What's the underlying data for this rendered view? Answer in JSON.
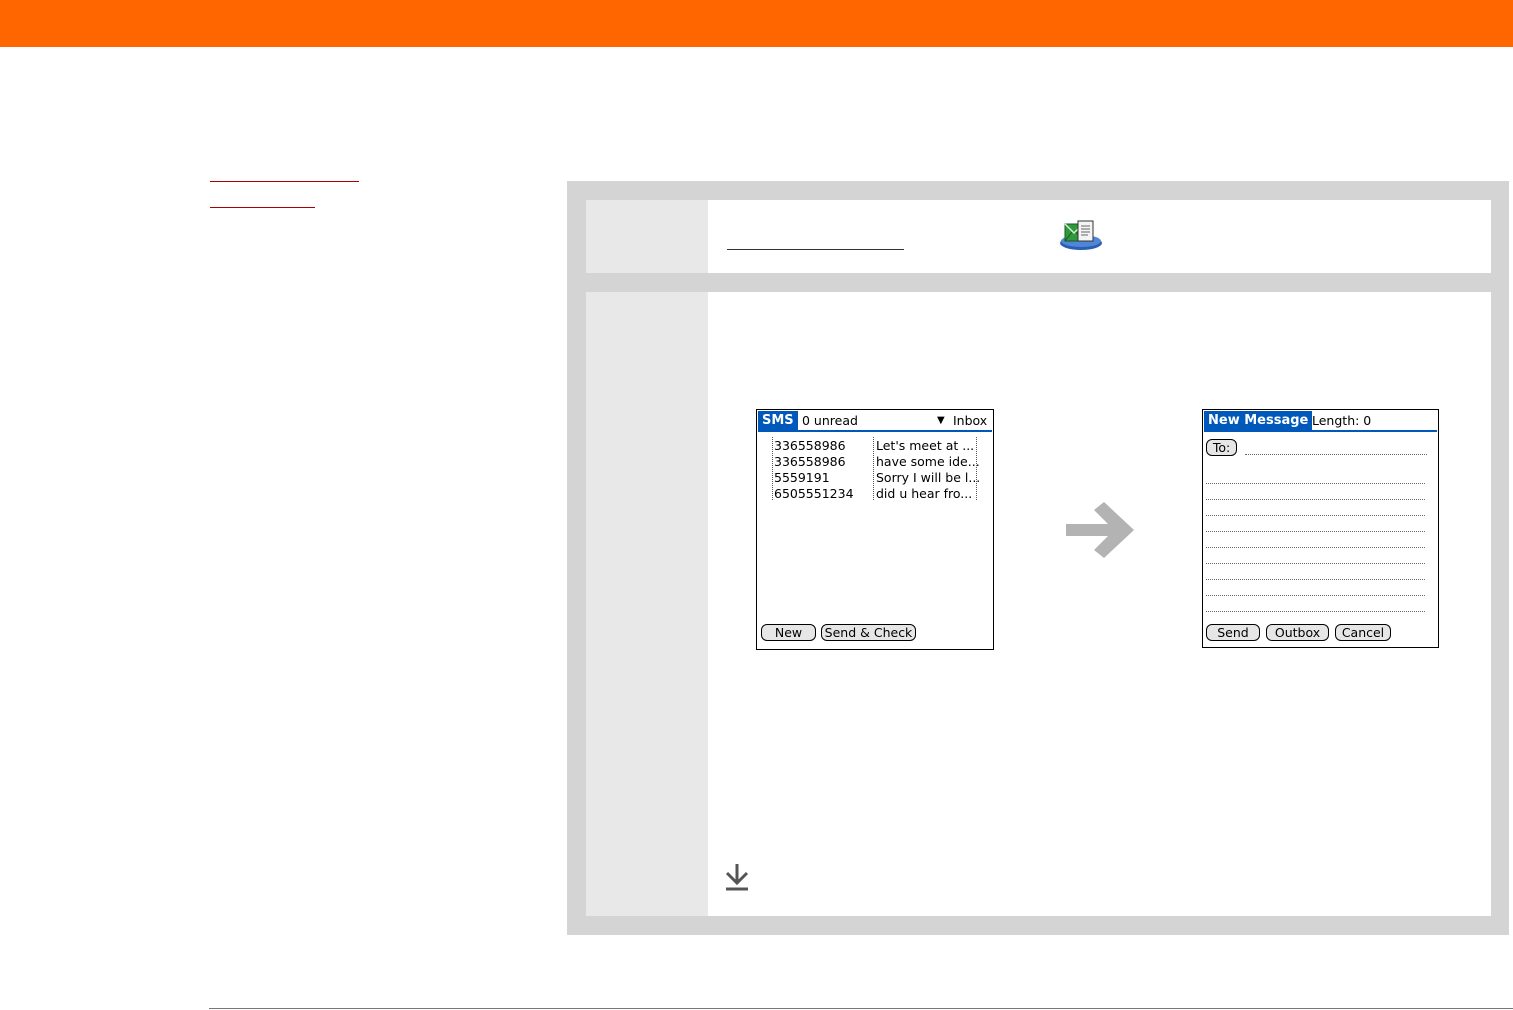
{
  "sms_screen": {
    "title": "SMS",
    "unread": "0 unread",
    "folder_arrow": "▼",
    "folder": "Inbox",
    "messages": [
      {
        "from": "336558986",
        "preview": "Let's meet at ..."
      },
      {
        "from": "336558986",
        "preview": "have some ide..."
      },
      {
        "from": "5559191",
        "preview": "Sorry I will be l..."
      },
      {
        "from": "6505551234",
        "preview": "did u hear fro..."
      }
    ],
    "buttons": {
      "new": "New",
      "send_check": "Send & Check"
    }
  },
  "new_message_screen": {
    "title": "New Message",
    "length": "Length: 0",
    "to_button": "To:",
    "buttons": {
      "send": "Send",
      "outbox": "Outbox",
      "cancel": "Cancel"
    }
  },
  "icons": {
    "app_icon": "messaging-app-icon",
    "arrow": "right-arrow-icon",
    "continue": "download-arrow-icon"
  },
  "colors": {
    "header": "#ff6600",
    "title_tab": "#0058bb",
    "panel": "#d4d4d4",
    "step_label": "#e8e8e8"
  }
}
